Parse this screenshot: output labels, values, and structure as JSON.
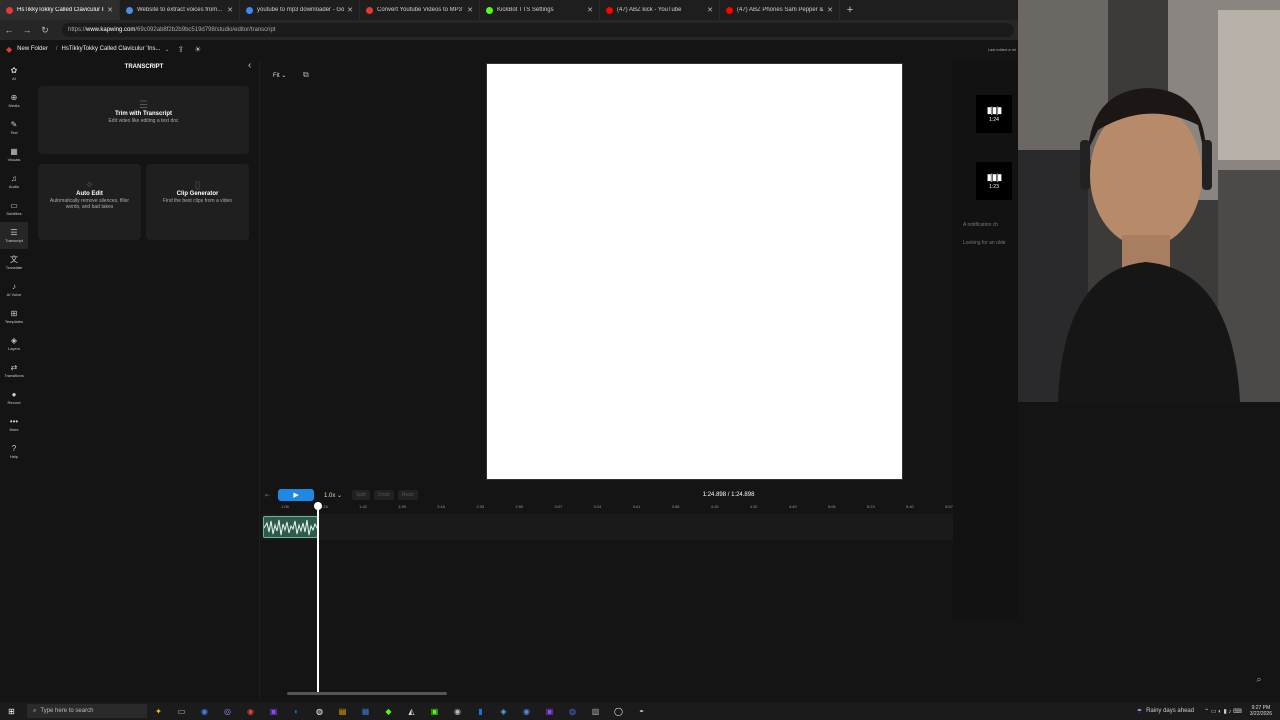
{
  "browser": {
    "tabs": [
      {
        "title": "HsTikkyTokky Called Claviculur Ins...",
        "active": true,
        "color": "#e53935"
      },
      {
        "title": "Website to extract voices from...",
        "active": false,
        "color": "#4a90e2"
      },
      {
        "title": "youtube to mp3 downloader - Go",
        "active": false,
        "color": "#4285f4"
      },
      {
        "title": "Convert Youtube Videos to MP3 fr",
        "active": false,
        "color": "#e53935"
      },
      {
        "title": "KickBot TTS Settings",
        "active": false,
        "color": "#53fc18"
      },
      {
        "title": "(47) ABZ kick - YouTube",
        "active": false,
        "color": "#ff0000"
      },
      {
        "title": "(47) ABZ Phones Sam Pepper & Sa",
        "active": false,
        "color": "#ff0000"
      }
    ],
    "new_tab": "+",
    "url_prefix": "https://",
    "url_domain": "www.kapwing.com",
    "url_path": "/69c092ab8f2b2b9bc519d798/studio/editor/transcript"
  },
  "app_header": {
    "folder": "New Folder",
    "project": "HsTikkyTokky Called Claviculur 'Ins...",
    "last_edited": "Last edited a mi"
  },
  "rail": [
    {
      "glyph": "✿",
      "label": "AI"
    },
    {
      "glyph": "⊕",
      "label": "Media"
    },
    {
      "glyph": "✎",
      "label": "Text"
    },
    {
      "glyph": "▦",
      "label": "Visuals"
    },
    {
      "glyph": "♫",
      "label": "Audio"
    },
    {
      "glyph": "▭",
      "label": "Subtitles"
    },
    {
      "glyph": "☰",
      "label": "Transcript",
      "active": true
    },
    {
      "glyph": "文",
      "label": "Translate"
    },
    {
      "glyph": "♪",
      "label": "AI Voice"
    },
    {
      "glyph": "⊞",
      "label": "Templates"
    },
    {
      "glyph": "◈",
      "label": "Layers"
    },
    {
      "glyph": "⇄",
      "label": "Transitions"
    },
    {
      "glyph": "●",
      "label": "Record"
    },
    {
      "glyph": "•••",
      "label": "More"
    },
    {
      "glyph": "?",
      "label": "Help"
    }
  ],
  "panel": {
    "title": "TRANSCRIPT",
    "trim": {
      "title": "Trim with Transcript",
      "sub": "Edit video like editing a text doc"
    },
    "auto": {
      "title": "Auto Edit",
      "sub": "Automatically remove silences, filler words, and bad takes"
    },
    "clip": {
      "title": "Clip Generator",
      "sub": "Find the best clips from a video"
    }
  },
  "stage": {
    "fit": "Fit"
  },
  "thumbs": [
    {
      "wave": "▮|▮|▮",
      "dur": "1:24"
    },
    {
      "wave": "▮|▮|▮",
      "dur": "1:23"
    }
  ],
  "notices": [
    "A notification ch",
    "Looking for an olde"
  ],
  "timeline": {
    "speed": "1.0x",
    "btn_split": "Split",
    "btn_undo": "Undo",
    "btn_redo": "Redo",
    "time": "1:24.898 / 1:24.898",
    "ticks": [
      "1:08",
      "1:25",
      "1:42",
      "1:59",
      "2:16",
      "2:33",
      "2:50",
      "3:07",
      "3:24",
      "3:41",
      "3:58",
      "4:15",
      "4:32",
      "4:49",
      "5:06",
      "5:23",
      "5:40",
      "5:57"
    ]
  },
  "taskbar": {
    "search": "Type here to search",
    "weather": "Rainy days ahead",
    "time": "9:27 PM",
    "date": "3/22/2026"
  }
}
